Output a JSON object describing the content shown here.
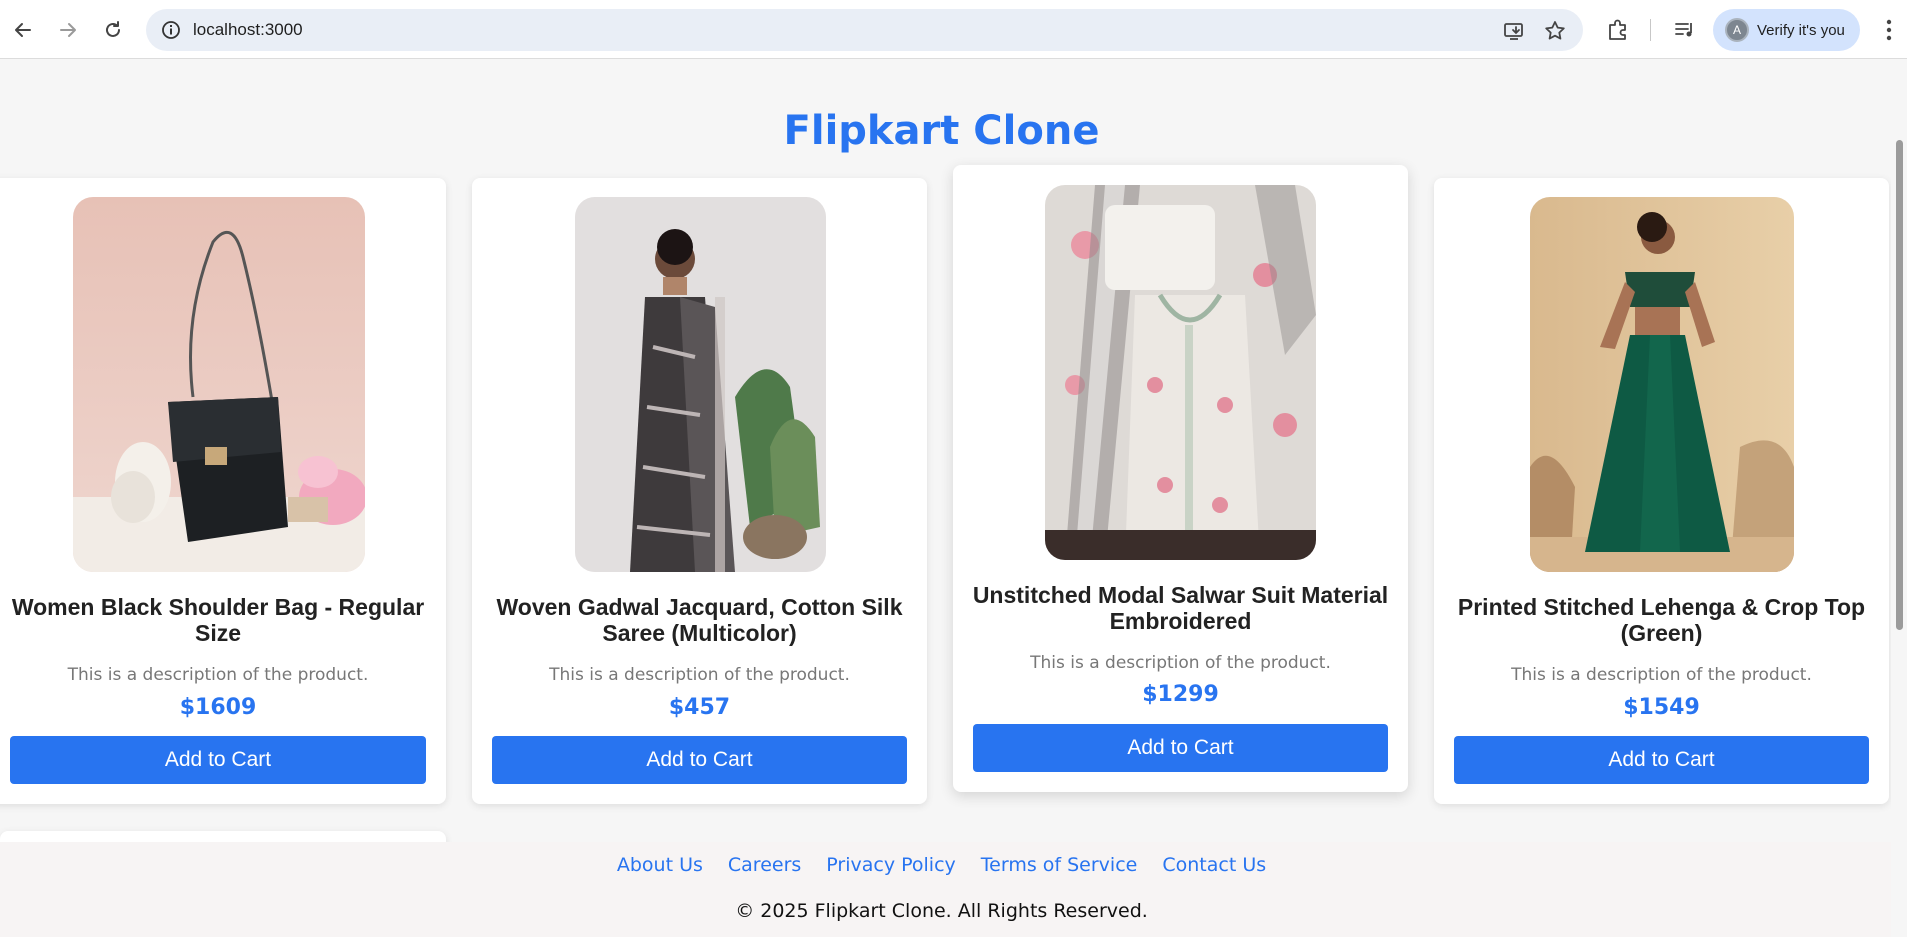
{
  "browser": {
    "url": "localhost:3000",
    "verify_label": "Verify it's you",
    "avatar_letter": "A",
    "icons": [
      "back-icon",
      "forward-icon",
      "reload-icon",
      "site-info-icon",
      "install-app-icon",
      "bookmark-star-icon",
      "extensions-icon",
      "media-controls-icon",
      "menu-icon"
    ]
  },
  "page": {
    "title": "Flipkart Clone",
    "accent_color": "#2874f0"
  },
  "products": [
    {
      "name": "Women Black Shoulder Bag - Regular Size",
      "description": "This is a description of the product.",
      "price": "$1609",
      "button_label": "Add to Cart"
    },
    {
      "name": "Woven Gadwal Jacquard, Cotton Silk Saree (Multicolor)",
      "description": "This is a description of the product.",
      "price": "$457",
      "button_label": "Add to Cart"
    },
    {
      "name": "Unstitched Modal Salwar Suit Material Embroidered",
      "description": "This is a description of the product.",
      "price": "$1299",
      "button_label": "Add to Cart"
    },
    {
      "name": "Printed Stitched Lehenga & Crop Top (Green)",
      "description": "This is a description of the product.",
      "price": "$1549",
      "button_label": "Add to Cart"
    }
  ],
  "footer": {
    "links": [
      "About Us",
      "Careers",
      "Privacy Policy",
      "Terms of Service",
      "Contact Us"
    ],
    "copyright": "© 2025 Flipkart Clone. All Rights Reserved."
  }
}
